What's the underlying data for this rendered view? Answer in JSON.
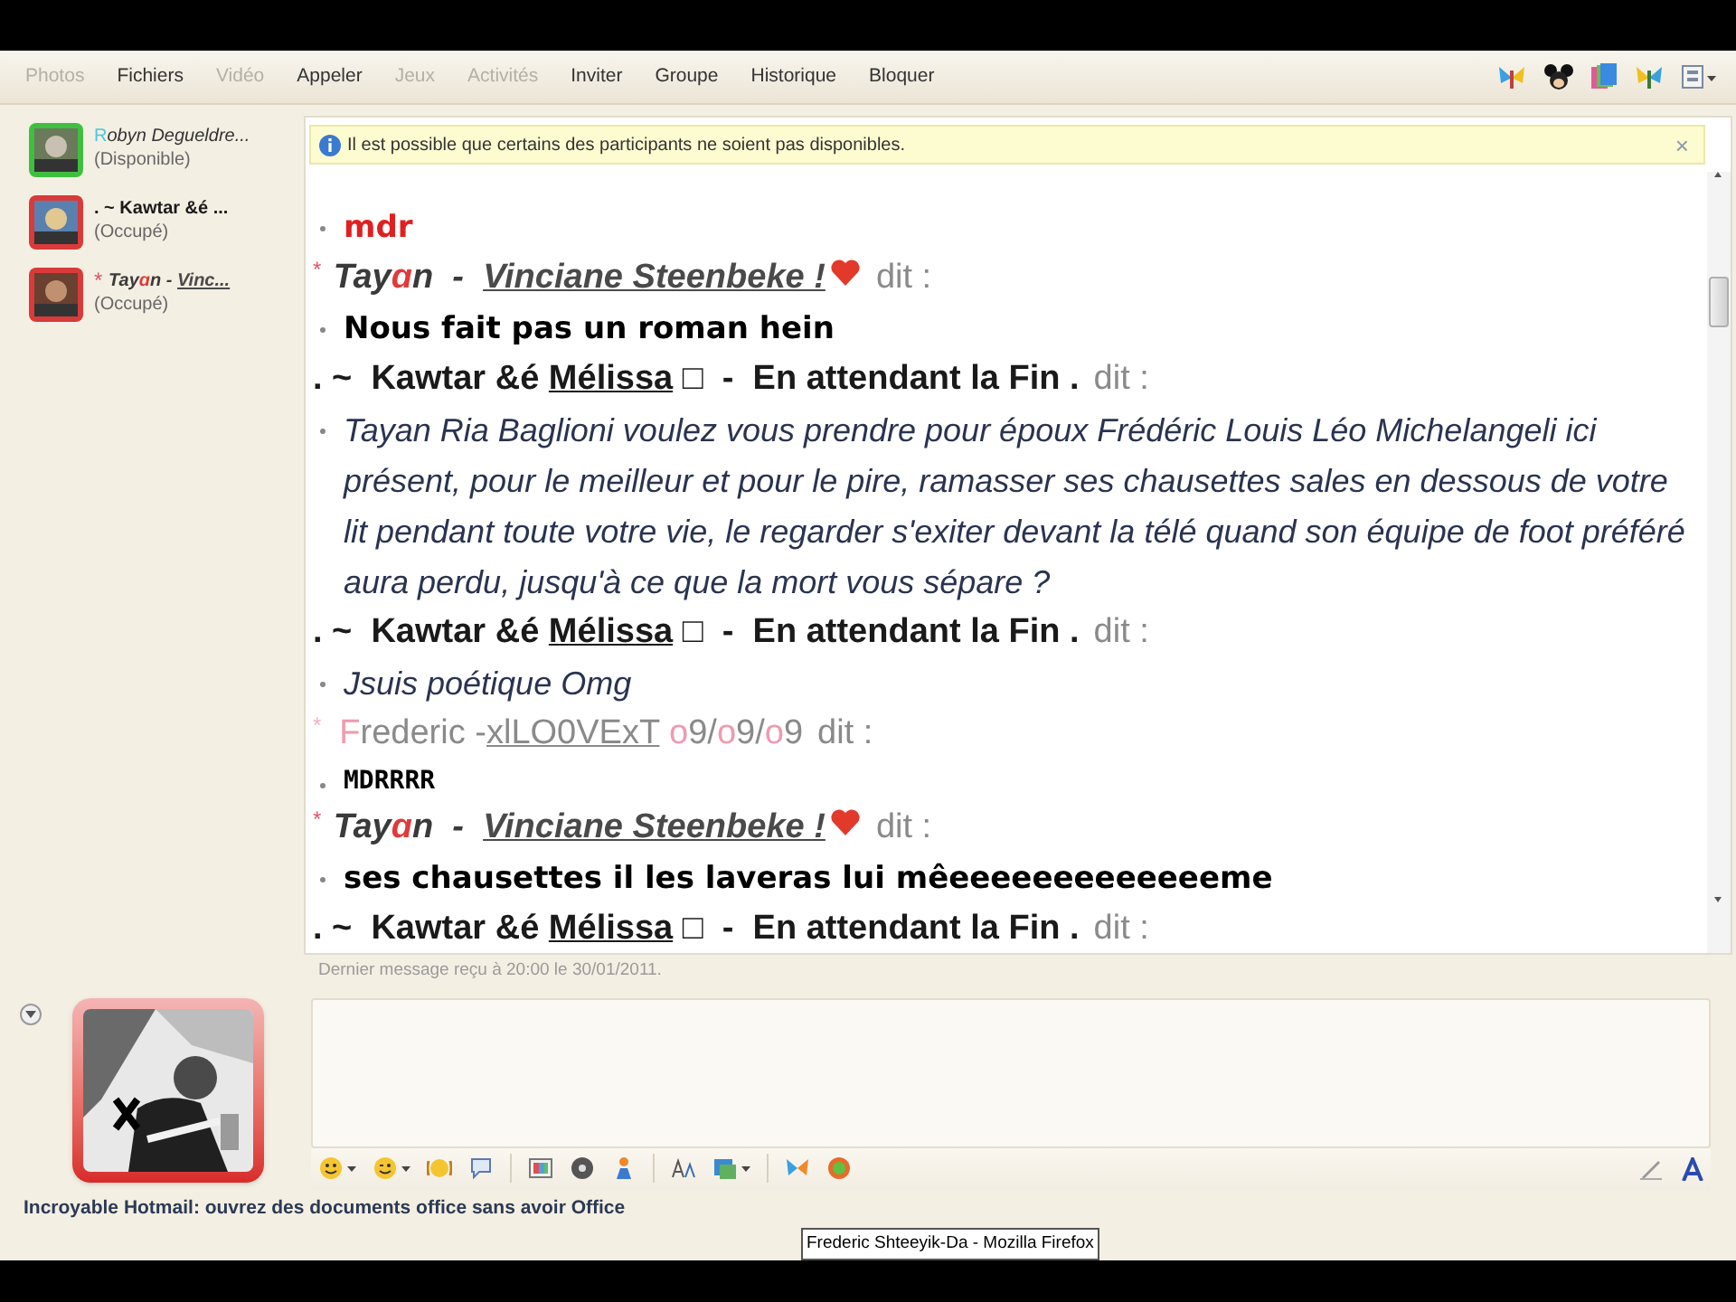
{
  "menu": [
    {
      "label": "Photos",
      "disabled": true
    },
    {
      "label": "Fichiers",
      "disabled": false
    },
    {
      "label": "Vidéo",
      "disabled": true
    },
    {
      "label": "Appeler",
      "disabled": false
    },
    {
      "label": "Jeux",
      "disabled": true
    },
    {
      "label": "Activités",
      "disabled": true
    },
    {
      "label": "Inviter",
      "disabled": false
    },
    {
      "label": "Groupe",
      "disabled": false
    },
    {
      "label": "Historique",
      "disabled": false
    },
    {
      "label": "Bloquer",
      "disabled": false
    }
  ],
  "contacts": [
    {
      "parts": [
        {
          "text": "R",
          "kind": "initial"
        },
        {
          "text": "obyn Degueldre...",
          "kind": "soft"
        }
      ],
      "status": "(Disponible)",
      "color": "#3fbf3f"
    },
    {
      "parts": [
        {
          "text": ". ~ Kawtar &é ...",
          "kind": "strong"
        }
      ],
      "status": "(Occupé)",
      "color": "#d93a3a"
    },
    {
      "parts": [
        {
          "text": "* ",
          "kind": "star"
        },
        {
          "text": "Tay",
          "kind": "nick"
        },
        {
          "text": "ɑ",
          "kind": "accent"
        },
        {
          "text": "n - ",
          "kind": "nick"
        },
        {
          "text": "Vinc...",
          "kind": "nick-link"
        }
      ],
      "status": "(Occupé)",
      "color": "#d93a3a"
    }
  ],
  "notification": {
    "text": "Il est possible que certains des participants ne soient pas disponibles.",
    "close": "×"
  },
  "conversation": [
    {
      "kind": "shout",
      "text": "mdr"
    },
    {
      "kind": "sender",
      "parts": [
        {
          "text": "*  ",
          "kind": "star"
        },
        {
          "text": "Tay",
          "kind": "nick"
        },
        {
          "text": "ɑ",
          "kind": "accent"
        },
        {
          "text": "n  -  ",
          "kind": "nick"
        },
        {
          "text": "Vinciane Steenbeke !",
          "kind": "nick-link"
        }
      ],
      "heart": true,
      "said": "dit :"
    },
    {
      "kind": "comic",
      "text": "Nous fait pas un roman hein"
    },
    {
      "kind": "sender",
      "parts": [
        {
          "text": ". ~  Kawtar &é ",
          "kind": "strong"
        },
        {
          "text": "Mélissa",
          "kind": "strong-link"
        },
        {
          "text": " □  -  En attendant la Fin .",
          "kind": "strong"
        }
      ],
      "heart": false,
      "said": "dit :"
    },
    {
      "kind": "italic",
      "text": "Tayan Ria Baglioni voulez vous prendre pour époux Frédéric Louis Léo Michelangeli ici présent, pour le meilleur et pour le pire, ramasser ses chausettes sales en dessous de votre lit pendant toute votre vie, le regarder s'exiter devant la télé quand son équipe de foot préféré aura perdu, jusqu'à ce que la mort vous sépare ?"
    },
    {
      "kind": "sender",
      "parts": [
        {
          "text": ". ~  Kawtar &é ",
          "kind": "strong"
        },
        {
          "text": "Mélissa",
          "kind": "strong-link"
        },
        {
          "text": " □  -  En attendant la Fin .",
          "kind": "strong"
        }
      ],
      "heart": false,
      "said": "dit :"
    },
    {
      "kind": "italic",
      "text": "Jsuis poétique Omg"
    },
    {
      "kind": "sender",
      "parts": [
        {
          "text": "*   ",
          "kind": "faint-star"
        },
        {
          "text": "F",
          "kind": "flourish"
        },
        {
          "text": "rederic -",
          "kind": "faint"
        },
        {
          "text": "xlLO0VExT",
          "kind": "faint-link"
        },
        {
          "text": " o",
          "kind": "flourish"
        },
        {
          "text": "9/",
          "kind": "faint"
        },
        {
          "text": "o",
          "kind": "flourish"
        },
        {
          "text": "9/",
          "kind": "faint"
        },
        {
          "text": "o",
          "kind": "flourish"
        },
        {
          "text": "9",
          "kind": "faint"
        }
      ],
      "heart": false,
      "said": "dit :"
    },
    {
      "kind": "mono",
      "text": "MDRRRR"
    },
    {
      "kind": "sender",
      "parts": [
        {
          "text": "*  ",
          "kind": "star"
        },
        {
          "text": "Tay",
          "kind": "nick"
        },
        {
          "text": "ɑ",
          "kind": "accent"
        },
        {
          "text": "n  -  ",
          "kind": "nick"
        },
        {
          "text": "Vinciane Steenbeke !",
          "kind": "nick-link"
        }
      ],
      "heart": true,
      "said": "dit :"
    },
    {
      "kind": "comic",
      "text": "ses chausettes il les laveras lui mêeeeeeeeeeeeeeme"
    },
    {
      "kind": "sender",
      "parts": [
        {
          "text": ". ~  Kawtar &é ",
          "kind": "strong"
        },
        {
          "text": "Mélissa",
          "kind": "strong-link"
        },
        {
          "text": " □  -  En attendant la Fin .",
          "kind": "strong"
        }
      ],
      "heart": false,
      "said": "dit :"
    }
  ],
  "last_message": "Dernier message reçu à 20:00 le 30/01/2011.",
  "footer": "Incroyable Hotmail: ouvrez des documents office sans avoir Office",
  "tooltip": "Frederic Shteeyik-Da - Mozilla Firefox"
}
